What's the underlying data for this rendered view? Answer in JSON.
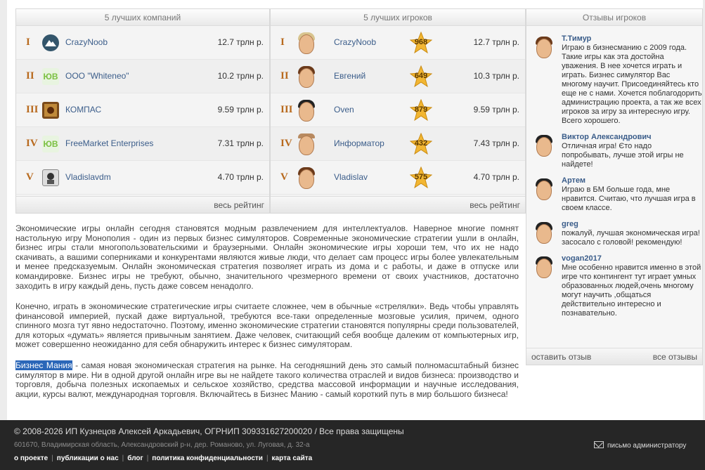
{
  "companies": {
    "title": "5 лучших компаний",
    "rows": [
      {
        "rank": "I",
        "name": "CrazyNoob",
        "money": "12.7 трлн  р."
      },
      {
        "rank": "II",
        "name": "ООО \"Whiteneo\"",
        "money": "10.2 трлн  р."
      },
      {
        "rank": "III",
        "name": "КОМПАС",
        "money": "9.59 трлн  р."
      },
      {
        "rank": "IV",
        "name": "FreeMarket Enterprises",
        "money": "7.31 трлн  р."
      },
      {
        "rank": "V",
        "name": "Vladislavdm",
        "money": "4.70 трлн  р."
      }
    ],
    "logo_text": "ЮВ",
    "footer_link": "весь рейтинг"
  },
  "players": {
    "title": "5 лучших игроков",
    "rows": [
      {
        "rank": "I",
        "name": "CrazyNoob",
        "level": "968",
        "money": "12.7 трлн  р."
      },
      {
        "rank": "II",
        "name": "Евгений",
        "level": "649",
        "money": "10.3 трлн  р."
      },
      {
        "rank": "III",
        "name": "Oven",
        "level": "879",
        "money": "9.59 трлн  р."
      },
      {
        "rank": "IV",
        "name": "Информатор",
        "level": "432",
        "money": "7.43 трлн  р."
      },
      {
        "rank": "V",
        "name": "Vladislav",
        "level": "575",
        "money": "4.70 трлн  р."
      }
    ],
    "footer_link": "весь рейтинг"
  },
  "reviews": {
    "title": "Отзывы игроков",
    "items": [
      {
        "name": "Т.Тимур",
        "text": "Играю в бизнесманию с 2009 года. Такие игры как эта достойна уважения. В нее хочется играть и играть. Бизнес симулятор Вас многому научит. Присоединяйтесь кто еще не с нами. Хочется поблагодорить администрацию проекта, а так же всех игроков за игру за интересную игру. Всего хорошего."
      },
      {
        "name": "Виктор Александрович",
        "text": "Отличная игра! Єто надо попробывать, лучше этой игры не найдете!"
      },
      {
        "name": "Артем",
        "text": "Играю в БМ больше года, мне нравится. Считаю, что лучшая игра в своем классе."
      },
      {
        "name": "greg",
        "text": "пожалуй, лучшая экономическая игра! засосало с головой! рекомендую!"
      },
      {
        "name": "vogan2017",
        "text": "Мне особенно нравится именно в этой игре что контингент тут играет умных образованных людей,очень многому могут научить ,общаться действительно интересно и познавательно."
      }
    ],
    "leave_review": "оставить отзыв",
    "all_reviews": "все отзывы"
  },
  "text": {
    "p1": "Экономические игры онлайн сегодня становятся модным развлечением для интеллектуалов. Наверное многие помнят настольную игру Монополия - один из первых бизнес симуляторов. Современные экономические стратегии ушли в онлайн, бизнес игры стали многопользовательскими и браузерными. Онлайн экономические игры хороши тем, что их не надо скачивать, а вашими соперниками и конкурентами являются живые люди, что делает сам процесс игры более увлекательным и менее предсказуемым. Онлайн экономическая стратегия позволяет играть из дома и с работы, и даже в отпуске или командировке. Бизнес игры не требуют, обычно, значительного чрезмерного времени от своих участников, достаточно заходить в игру каждый день, пусть даже совсем ненадолго.",
    "p2": "Конечно, играть в экономические стратегические игры считаете сложнее, чем в обычные «стрелялки». Ведь чтобы управлять финансовой империей, пускай даже виртуальной, требуются все-таки определенные мозговые усилия, причем, одного спинного мозга тут явно недостаточно. Поэтому, именно экономические стратегии становятся популярны среди пользователей, для которых «думать» является привычным занятием. Даже человек, считающий себя вообще далеким от компьютерных игр, может совершенно неожиданно для себя обнаружить интерес к бизнес симуляторам.",
    "p3_highlight": "Бизнес Мания",
    "p3_rest": " - самая новая экономическая стратегия на рынке. На сегодняшний день это самый полномасштабный бизнес симулятор в мире. Ни в одной другой онлайн игре вы не найдете такого количества отраслей и видов бизнеса: производство и торговля, добыча полезных ископаемых и сельское хозяйство, средства массовой информации и научные исследования, акции, курсы валют, международная торговля. Включайтесь в Бизнес Манию - самый короткий путь в мир большого бизнеса!"
  },
  "footer": {
    "copyright": "© 2008-2026 ИП Кузнецов Алексей Аркадьевич, ОГРНИП 309331627200020 / Все права защищены",
    "address": "601670, Владимирская область, Александровский р-н, дер. Романово, ул. Луговая, д. 32-а",
    "mail_link": "письмо администратору",
    "links": [
      "о проекте",
      "публикации о нас",
      "блог",
      "политика конфиденциальности",
      "карта сайта"
    ]
  },
  "colors": {
    "rank": "#b86a1e",
    "link": "#3b5d8a",
    "footer_bg": "#262626",
    "highlight": "#2a66b8"
  }
}
